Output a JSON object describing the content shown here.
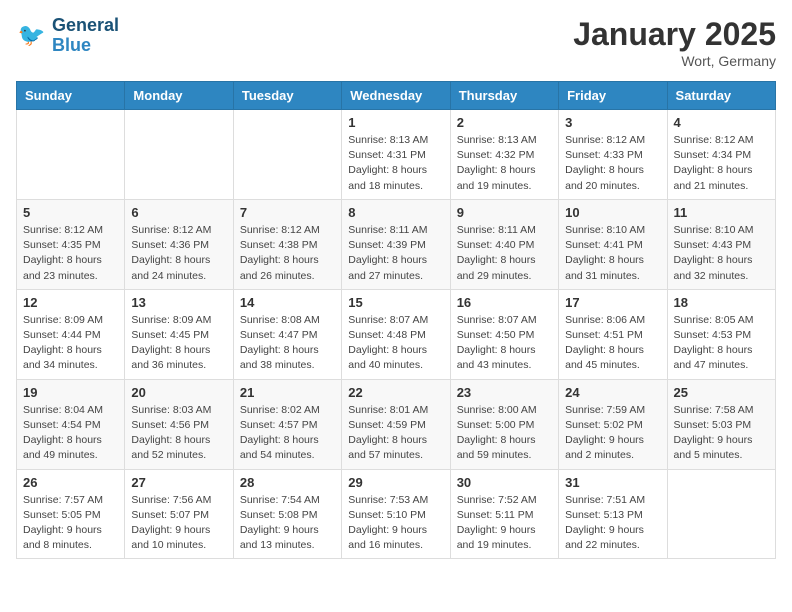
{
  "logo": {
    "line1": "General",
    "line2": "Blue"
  },
  "title": "January 2025",
  "location": "Wort, Germany",
  "weekdays": [
    "Sunday",
    "Monday",
    "Tuesday",
    "Wednesday",
    "Thursday",
    "Friday",
    "Saturday"
  ],
  "weeks": [
    [
      {
        "day": "",
        "info": ""
      },
      {
        "day": "",
        "info": ""
      },
      {
        "day": "",
        "info": ""
      },
      {
        "day": "1",
        "info": "Sunrise: 8:13 AM\nSunset: 4:31 PM\nDaylight: 8 hours\nand 18 minutes."
      },
      {
        "day": "2",
        "info": "Sunrise: 8:13 AM\nSunset: 4:32 PM\nDaylight: 8 hours\nand 19 minutes."
      },
      {
        "day": "3",
        "info": "Sunrise: 8:12 AM\nSunset: 4:33 PM\nDaylight: 8 hours\nand 20 minutes."
      },
      {
        "day": "4",
        "info": "Sunrise: 8:12 AM\nSunset: 4:34 PM\nDaylight: 8 hours\nand 21 minutes."
      }
    ],
    [
      {
        "day": "5",
        "info": "Sunrise: 8:12 AM\nSunset: 4:35 PM\nDaylight: 8 hours\nand 23 minutes."
      },
      {
        "day": "6",
        "info": "Sunrise: 8:12 AM\nSunset: 4:36 PM\nDaylight: 8 hours\nand 24 minutes."
      },
      {
        "day": "7",
        "info": "Sunrise: 8:12 AM\nSunset: 4:38 PM\nDaylight: 8 hours\nand 26 minutes."
      },
      {
        "day": "8",
        "info": "Sunrise: 8:11 AM\nSunset: 4:39 PM\nDaylight: 8 hours\nand 27 minutes."
      },
      {
        "day": "9",
        "info": "Sunrise: 8:11 AM\nSunset: 4:40 PM\nDaylight: 8 hours\nand 29 minutes."
      },
      {
        "day": "10",
        "info": "Sunrise: 8:10 AM\nSunset: 4:41 PM\nDaylight: 8 hours\nand 31 minutes."
      },
      {
        "day": "11",
        "info": "Sunrise: 8:10 AM\nSunset: 4:43 PM\nDaylight: 8 hours\nand 32 minutes."
      }
    ],
    [
      {
        "day": "12",
        "info": "Sunrise: 8:09 AM\nSunset: 4:44 PM\nDaylight: 8 hours\nand 34 minutes."
      },
      {
        "day": "13",
        "info": "Sunrise: 8:09 AM\nSunset: 4:45 PM\nDaylight: 8 hours\nand 36 minutes."
      },
      {
        "day": "14",
        "info": "Sunrise: 8:08 AM\nSunset: 4:47 PM\nDaylight: 8 hours\nand 38 minutes."
      },
      {
        "day": "15",
        "info": "Sunrise: 8:07 AM\nSunset: 4:48 PM\nDaylight: 8 hours\nand 40 minutes."
      },
      {
        "day": "16",
        "info": "Sunrise: 8:07 AM\nSunset: 4:50 PM\nDaylight: 8 hours\nand 43 minutes."
      },
      {
        "day": "17",
        "info": "Sunrise: 8:06 AM\nSunset: 4:51 PM\nDaylight: 8 hours\nand 45 minutes."
      },
      {
        "day": "18",
        "info": "Sunrise: 8:05 AM\nSunset: 4:53 PM\nDaylight: 8 hours\nand 47 minutes."
      }
    ],
    [
      {
        "day": "19",
        "info": "Sunrise: 8:04 AM\nSunset: 4:54 PM\nDaylight: 8 hours\nand 49 minutes."
      },
      {
        "day": "20",
        "info": "Sunrise: 8:03 AM\nSunset: 4:56 PM\nDaylight: 8 hours\nand 52 minutes."
      },
      {
        "day": "21",
        "info": "Sunrise: 8:02 AM\nSunset: 4:57 PM\nDaylight: 8 hours\nand 54 minutes."
      },
      {
        "day": "22",
        "info": "Sunrise: 8:01 AM\nSunset: 4:59 PM\nDaylight: 8 hours\nand 57 minutes."
      },
      {
        "day": "23",
        "info": "Sunrise: 8:00 AM\nSunset: 5:00 PM\nDaylight: 8 hours\nand 59 minutes."
      },
      {
        "day": "24",
        "info": "Sunrise: 7:59 AM\nSunset: 5:02 PM\nDaylight: 9 hours\nand 2 minutes."
      },
      {
        "day": "25",
        "info": "Sunrise: 7:58 AM\nSunset: 5:03 PM\nDaylight: 9 hours\nand 5 minutes."
      }
    ],
    [
      {
        "day": "26",
        "info": "Sunrise: 7:57 AM\nSunset: 5:05 PM\nDaylight: 9 hours\nand 8 minutes."
      },
      {
        "day": "27",
        "info": "Sunrise: 7:56 AM\nSunset: 5:07 PM\nDaylight: 9 hours\nand 10 minutes."
      },
      {
        "day": "28",
        "info": "Sunrise: 7:54 AM\nSunset: 5:08 PM\nDaylight: 9 hours\nand 13 minutes."
      },
      {
        "day": "29",
        "info": "Sunrise: 7:53 AM\nSunset: 5:10 PM\nDaylight: 9 hours\nand 16 minutes."
      },
      {
        "day": "30",
        "info": "Sunrise: 7:52 AM\nSunset: 5:11 PM\nDaylight: 9 hours\nand 19 minutes."
      },
      {
        "day": "31",
        "info": "Sunrise: 7:51 AM\nSunset: 5:13 PM\nDaylight: 9 hours\nand 22 minutes."
      },
      {
        "day": "",
        "info": ""
      }
    ]
  ]
}
